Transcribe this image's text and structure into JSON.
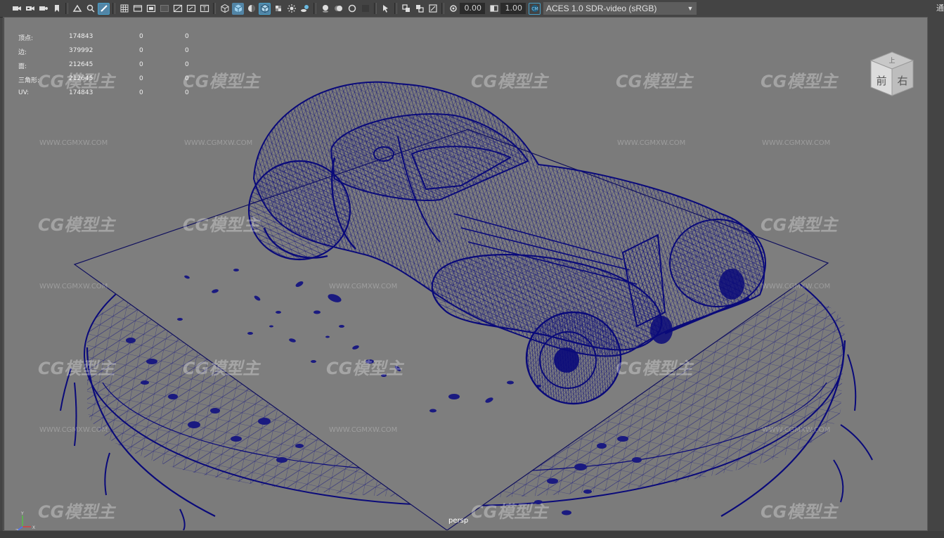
{
  "toolbar": {
    "icons": [
      "camera-icon",
      "camera-attribute-icon",
      "camera-bookmark-icon",
      "bookmark-icon",
      "image-plane-icon",
      "2d-pan-zoom-icon",
      "grease-pencil-icon",
      "grid-icon",
      "film-gate-icon",
      "resolution-gate-icon",
      "gate-mask-icon",
      "field-chart-icon",
      "safe-action-icon",
      "safe-title-icon",
      "wireframe-icon",
      "smooth-shade-icon",
      "shaded-wireframe-icon",
      "wireframe-on-shaded-icon",
      "textured-icon",
      "use-all-lights-icon",
      "shadows-icon",
      "screen-space-ao-icon",
      "motion-blur-icon",
      "anti-aliasing-icon",
      "depth-of-field-icon",
      "isolate-select-icon",
      "xray-icon",
      "xray-active-components-icon",
      "xray-joints-icon",
      "backface-culling-icon",
      "exposure-icon",
      "gamma-icon",
      "color-management-icon"
    ],
    "exposure_value": "0.00",
    "gamma_value": "1.00",
    "colorspace": "ACES 1.0 SDR-video (sRGB)"
  },
  "hud": {
    "rows": [
      {
        "label": "顶点:",
        "v1": "174843",
        "v2": "0",
        "v3": "0"
      },
      {
        "label": "边:",
        "v1": "379992",
        "v2": "0",
        "v3": "0"
      },
      {
        "label": "面:",
        "v1": "212645",
        "v2": "0",
        "v3": "0"
      },
      {
        "label": "三角形:",
        "v1": "212645",
        "v2": "0",
        "v3": "0"
      },
      {
        "label": "UV:",
        "v1": "174843",
        "v2": "0",
        "v3": "0"
      }
    ]
  },
  "viewport": {
    "camera": "persp",
    "background_color": "#7b7b7b",
    "wire_color": "#0a0a7a"
  },
  "viewcube": {
    "top": "上",
    "front": "前",
    "right": "右"
  },
  "axis": {
    "x": "X",
    "y": "Y",
    "z": "Z"
  },
  "watermark": {
    "logo": "CG模型主",
    "url": "WWW.CGMXW.COM"
  },
  "right_strip_text": "通"
}
